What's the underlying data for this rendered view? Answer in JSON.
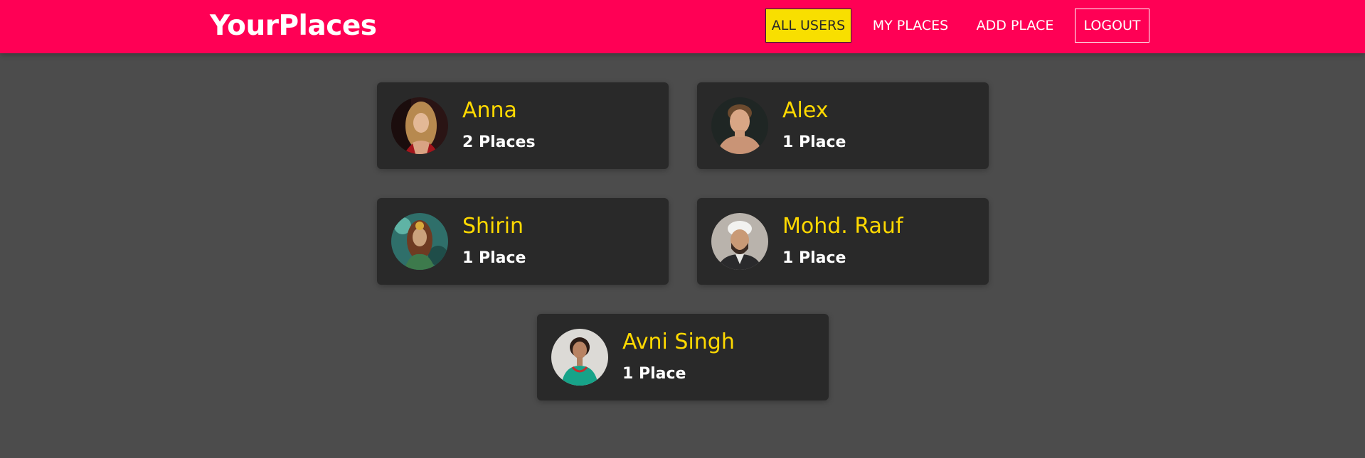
{
  "header": {
    "logo": "YourPlaces",
    "nav": [
      {
        "label": "ALL USERS",
        "active": true
      },
      {
        "label": "MY PLACES",
        "active": false
      },
      {
        "label": "ADD PLACE",
        "active": false
      },
      {
        "label": "LOGOUT",
        "active": false
      }
    ]
  },
  "users": [
    {
      "name": "Anna",
      "places": "2 Places",
      "avatar": "user-avatar-photo"
    },
    {
      "name": "Alex",
      "places": "1 Place",
      "avatar": "user-avatar-photo"
    },
    {
      "name": "Shirin",
      "places": "1 Place",
      "avatar": "user-avatar-photo"
    },
    {
      "name": "Mohd. Rauf",
      "places": "1 Place",
      "avatar": "user-avatar-photo"
    },
    {
      "name": "Avni Singh",
      "places": "1 Place",
      "avatar": "user-avatar-photo"
    }
  ],
  "colors": {
    "header_bg": "#ff0055",
    "page_bg": "#4c4c4c",
    "card_bg": "#292929",
    "name_color": "#ffd900",
    "active_nav_bg": "#f8df00"
  }
}
